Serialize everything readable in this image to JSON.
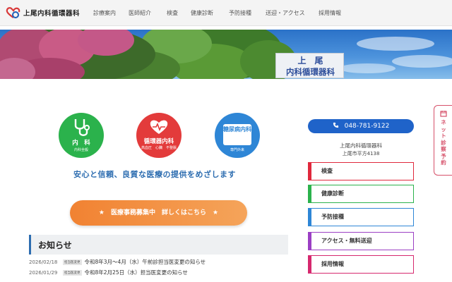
{
  "header": {
    "logo_text": "上尾内科循環器科",
    "nav": [
      "診療案内",
      "医師紹介",
      "検査",
      "健康診断",
      "予防接種",
      "送迎・アクセス",
      "採用情報"
    ]
  },
  "hero": {
    "sign_line1": "上尾",
    "sign_line2": "内科循環器科"
  },
  "departments": [
    {
      "title": "内　科",
      "sub": "内科全般",
      "color": "#2bb24c",
      "icon": "stethoscope-icon"
    },
    {
      "title": "循環器内科",
      "sub": "高血圧　心臓　不整脈",
      "color": "#e33b3b",
      "icon": "heart-pulse-icon"
    },
    {
      "title": "糖尿病内科",
      "sub": "専門外来",
      "color": "#2e86d6",
      "icon": "badge-icon"
    }
  ],
  "tagline": "安心と信頼、良質な医療の提供をめざします",
  "recruit_banner": "★　医療事務募集中　詳しくはこちら　★",
  "news": {
    "title": "お知らせ",
    "items": [
      {
        "date": "2026/02/18",
        "badge": "担当医変更",
        "text": "令和8年3月〜4月（水）午前診担当医変更の知らせ"
      },
      {
        "date": "2026/01/29",
        "badge": "担当医変更",
        "text": "令和8年2月25日（水）担当医変更の知らせ"
      }
    ]
  },
  "contact": {
    "phone": "048-781-9122",
    "clinic_name": "上尾内科循環器科",
    "address": "上尾市平方4138"
  },
  "side_buttons": [
    {
      "label": "検査",
      "color": "#e0283c"
    },
    {
      "label": "健康診断",
      "color": "#2bb24c"
    },
    {
      "label": "予防接種",
      "color": "#2e86d6"
    },
    {
      "label": "アクセス・無料送迎",
      "color": "#9b3fc4"
    },
    {
      "label": "採用情報",
      "color": "#d6286e"
    }
  ],
  "net_reservation": "ネット診察予約"
}
